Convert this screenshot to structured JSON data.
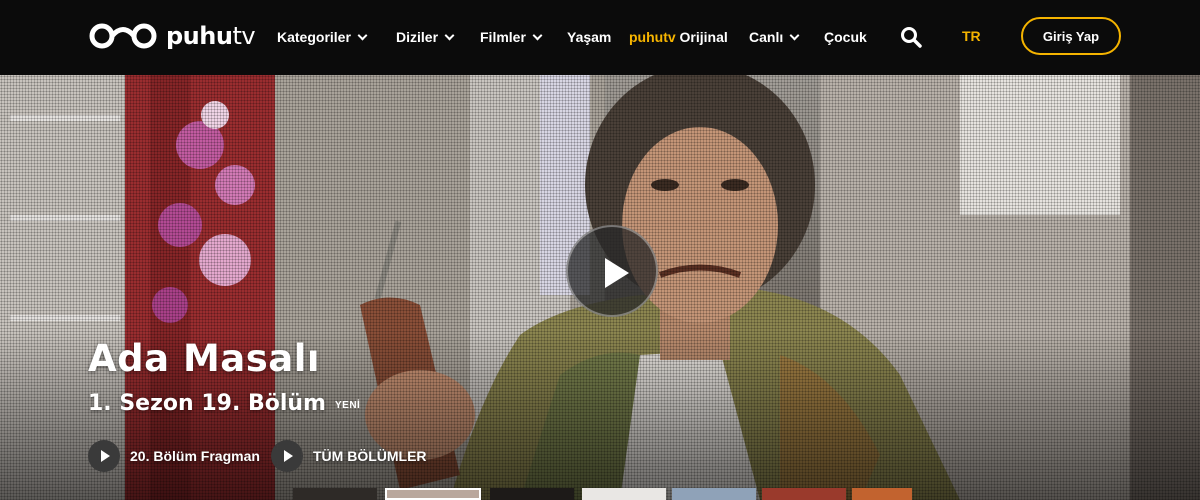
{
  "header": {
    "logo": {
      "brand": "puhu",
      "brand_suffix": "tv"
    },
    "nav": [
      {
        "label": "Kategoriler",
        "dropdown": true
      },
      {
        "label": "Diziler",
        "dropdown": true
      },
      {
        "label": "Filmler",
        "dropdown": true
      },
      {
        "label": "Yaşam",
        "dropdown": false
      },
      {
        "label_brand": "puhutv",
        "label": "Orijinal",
        "dropdown": false
      },
      {
        "label": "Canlı",
        "dropdown": true
      },
      {
        "label": "Çocuk",
        "dropdown": false
      }
    ],
    "search_icon": "search-icon",
    "language": "TR",
    "login_label": "Giriş Yap"
  },
  "hero": {
    "title": "Ada Masalı",
    "episode": "1. Sezon 19. Bölüm",
    "badge": "YENİ",
    "actions": [
      {
        "label": "20. Bölüm Fragman",
        "icon": "play-icon"
      },
      {
        "label": "TÜM BÖLÜMLER",
        "icon": "play-icon"
      }
    ]
  },
  "colors": {
    "accent": "#f5b400",
    "header_bg": "#0b0b0b",
    "action_circle": "#3a3a3a"
  }
}
